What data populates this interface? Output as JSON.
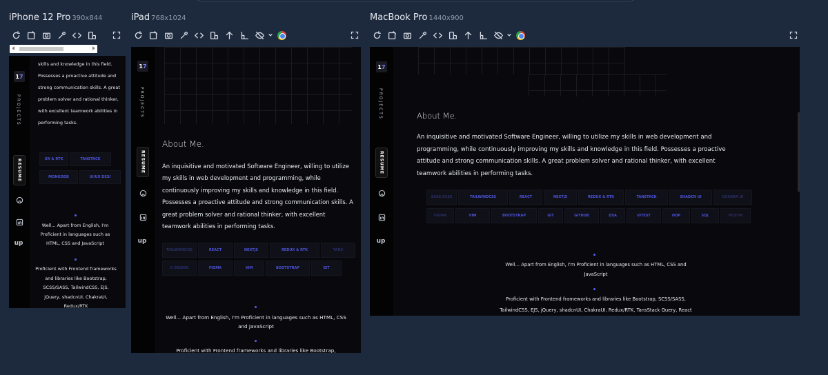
{
  "devices": [
    {
      "name": "iPhone 12 Pro",
      "dims": "390x844"
    },
    {
      "name": "iPad",
      "dims": "768x1024"
    },
    {
      "name": "MacBook Pro",
      "dims": "1440x900"
    }
  ],
  "site": {
    "logo_a": "1",
    "logo_b": "7",
    "side_label": "PROJECTS",
    "resume_label": "RESUME",
    "upwork_label": "up",
    "about_title": "About Me.",
    "about_text": "An inquisitive and motivated Software Engineer, willing to utilize my skills in web development and programming, while continuously improving my skills and knowledge in this field. Possesses a proactive attitude and strong communication skills. A great problem solver and rational thinker, with excellent teamwork abilities in performing tasks.",
    "iphone_top_text": "skills and knowledge in this field. Possesses a proactive attitude and strong communication skills. A great problem solver and rational thinker, with excellent teamwork abilities in performing tasks.",
    "lang_text": "Well... Apart from English, I'm Proficient in languages such as HTML, CSS and JavaScript",
    "frontend_text_iphone": "Proficient with Frontend frameworks and libraries like Bootstrap, SCSS/SASS, TailwindCSS, EJS, jQuery, shadcnUI, ChakraUI, Redux/RTK",
    "frontend_text_ipad": "Proficient with Frontend frameworks and libraries like Bootstrap, SCSS/SASS,",
    "frontend_text_mac": "Proficient with Frontend frameworks and libraries like Bootstrap, SCSS/SASS, TailwindCSS, EJS, jQuery, shadcnUI, ChakraUI, Redux/RTK, TansStack Query, React"
  },
  "skills": {
    "iphone_row1": [
      "UX & RTK",
      "TANSTACK"
    ],
    "iphone_row2": [
      "MONGODB",
      "UI/UX DESI"
    ],
    "ipad_row1": [
      "TAILWINDCSS",
      "REACT",
      "NEXTJS",
      "REDUX & RTK",
      "TANS"
    ],
    "ipad_row2": [
      "X DESIGN",
      "FIGMA",
      "VIM",
      "BOOTSTRAP",
      "GIT"
    ],
    "mac_row1": [
      "SASS/SCSS",
      "TAILWINDCSS",
      "REACT",
      "NEXTJS",
      "REDUX & RTK",
      "TANSTACK",
      "SHADCN UI",
      "CHAKRA UI"
    ],
    "mac_row2": [
      "FIGMA",
      "VIM",
      "BOOTSTRAP",
      "GIT",
      "GITHUB",
      "DSA",
      "VITEST",
      "OOP",
      "SQL",
      "POSTM"
    ]
  }
}
